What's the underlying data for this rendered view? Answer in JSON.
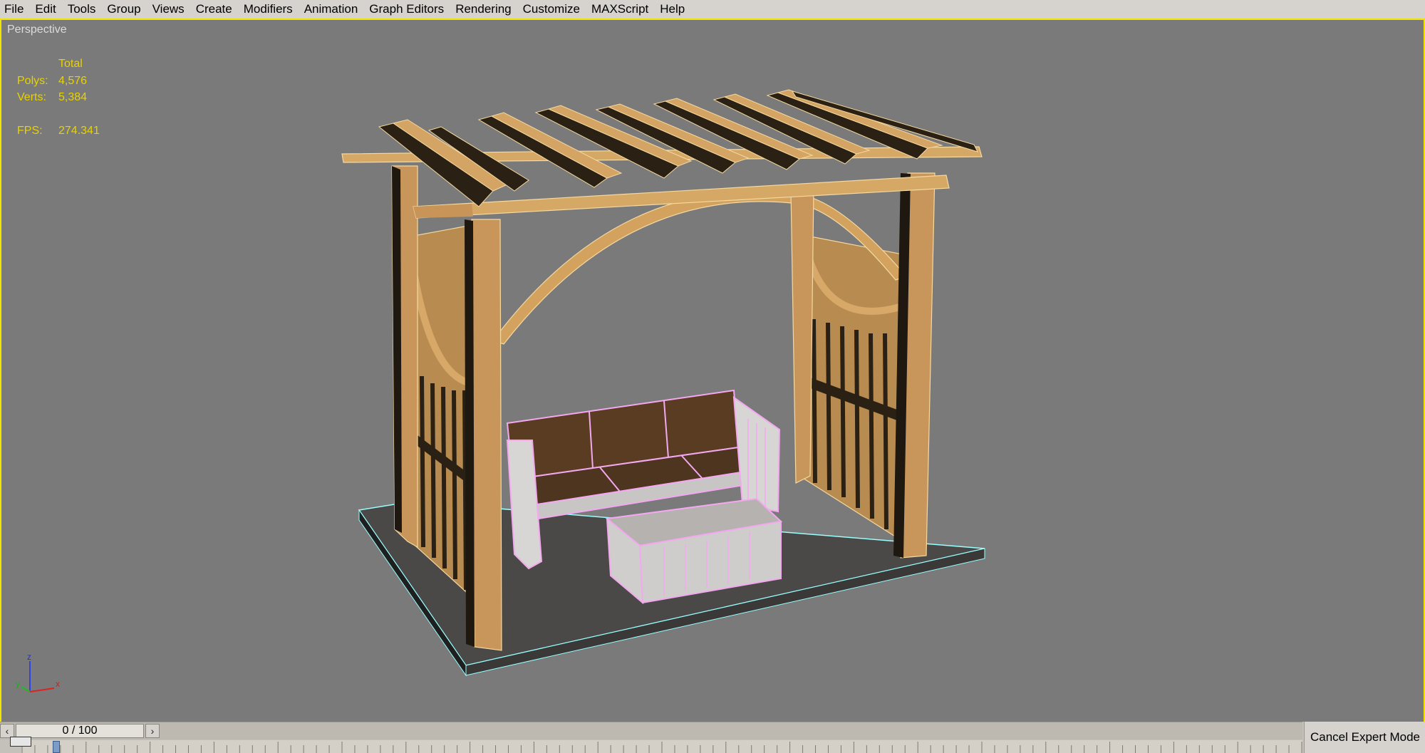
{
  "menubar": {
    "items": [
      "File",
      "Edit",
      "Tools",
      "Group",
      "Views",
      "Create",
      "Modifiers",
      "Animation",
      "Graph Editors",
      "Rendering",
      "Customize",
      "MAXScript",
      "Help"
    ]
  },
  "viewport": {
    "label": "Perspective",
    "stats": {
      "header": "Total",
      "polys_label": "Polys:",
      "polys_value": "4,576",
      "verts_label": "Verts:",
      "verts_value": "5,384",
      "fps_label": "FPS:",
      "fps_value": "274.341"
    },
    "axis": {
      "z": "z",
      "y": "y",
      "x": "x"
    },
    "background_color": "#7a7a7a",
    "border_color": "#f2e600"
  },
  "timeline": {
    "frame_display": "0 / 100",
    "prev_icon": "chevron-left-icon",
    "next_icon": "chevron-right-icon"
  },
  "status": {
    "cancel_expert_label": "Cancel Expert Mode"
  }
}
